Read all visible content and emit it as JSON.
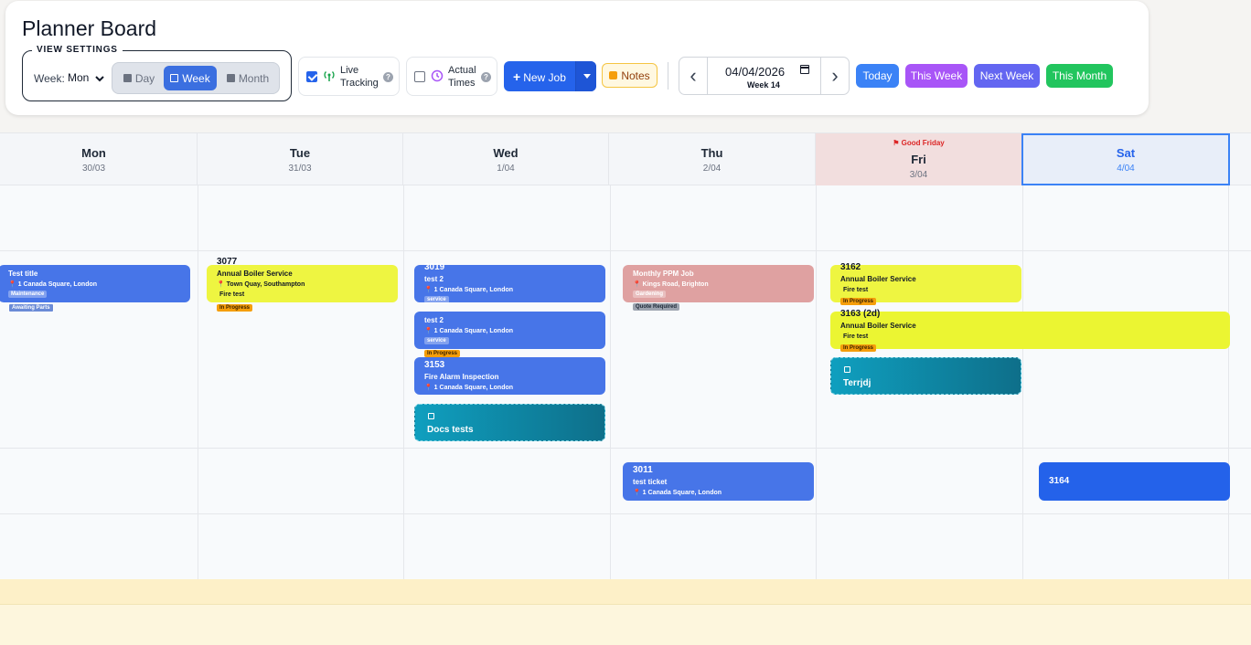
{
  "header": {
    "title": "Planner Board",
    "view_settings_legend": "VIEW SETTINGS",
    "week_label": "Week:",
    "week_start": "Mon",
    "views": [
      {
        "label": "Day",
        "active": false
      },
      {
        "label": "Week",
        "active": true
      },
      {
        "label": "Month",
        "active": false
      }
    ],
    "live_tracking": {
      "label_line1": "Live",
      "label_line2": "Tracking",
      "checked": true
    },
    "actual_times": {
      "label_line1": "Actual",
      "label_line2": "Times",
      "checked": false
    },
    "help_glyph": "?",
    "new_job_label": "New Job",
    "notes_label": "Notes",
    "date_value": "04/04/2026",
    "week_number": "Week 14",
    "prev_glyph": "‹",
    "next_glyph": "›",
    "quick": [
      {
        "label": "Today",
        "color": "#3b82f6"
      },
      {
        "label": "This Week",
        "color": "#a855f7"
      },
      {
        "label": "Next Week",
        "color": "#6366f1"
      },
      {
        "label": "This Month",
        "color": "#22c55e"
      }
    ]
  },
  "days": [
    {
      "name": "Mon",
      "date": "30/03"
    },
    {
      "name": "Tue",
      "date": "31/03"
    },
    {
      "name": "Wed",
      "date": "1/04"
    },
    {
      "name": "Thu",
      "date": "2/04"
    },
    {
      "name": "Fri",
      "date": "3/04",
      "holiday": "Good Friday"
    },
    {
      "name": "Sat",
      "date": "4/04",
      "today": true
    }
  ],
  "jobs": {
    "mon_1": {
      "title": "Test title",
      "location": "1 Canada Square, London",
      "category": "Maintenance",
      "status": "Awaiting Parts"
    },
    "tue_1": {
      "number": "3077",
      "title": "Annual Boiler Service",
      "location": "Town Quay, Southampton",
      "detail": "Fire test",
      "status": "In Progress"
    },
    "wed_1": {
      "number": "3019",
      "title": "test 2",
      "location": "1 Canada Square, London",
      "category": "service"
    },
    "wed_2": {
      "title": "test 2",
      "location": "1 Canada Square, London",
      "category": "service",
      "status": "In Progress"
    },
    "wed_3": {
      "number": "3153",
      "title": "Fire Alarm Inspection",
      "location": "1 Canada Square, London"
    },
    "wed_4": {
      "title": "Docs tests"
    },
    "thu_1": {
      "title": "Monthly PPM Job",
      "location": "Kings Road, Brighton",
      "category": "Gardening",
      "status": "Quote Required"
    },
    "thu_2": {
      "number": "3011",
      "title": "test ticket",
      "location": "1 Canada Square, London"
    },
    "fri_1": {
      "number": "3162",
      "title": "Annual Boiler Service",
      "detail": "Fire test",
      "status": "In Progress"
    },
    "fri_2": {
      "number": "3163 (2d)",
      "title": "Annual Boiler Service",
      "detail": "Fire test",
      "status": "In Progress"
    },
    "fri_3": {
      "title": "Terrjdj"
    },
    "sat_1": {
      "number": "3164"
    }
  },
  "colors": {
    "accent": "#2563eb",
    "holiday": "#dc2626"
  }
}
